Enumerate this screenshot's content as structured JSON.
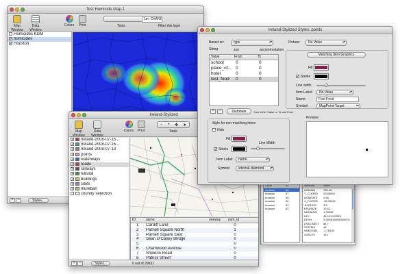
{
  "map_window": {
    "title": "Test Homicide Map-1",
    "toolbar": {
      "map_window": "Map Window",
      "data_window": "Data Window",
      "colors": "Colors",
      "print": "Print",
      "tools": "Tools",
      "zoom_value": "1in: CHANGE",
      "filter_label": "Filter this layer"
    },
    "layers": [
      {
        "name": "Homicides KDM",
        "checked": false,
        "selected": false
      },
      {
        "name": "homicides",
        "checked": true,
        "selected": true
      },
      {
        "name": "Houston",
        "checked": true,
        "selected": false
      }
    ],
    "footer": {
      "add": "+",
      "remove": "−",
      "styles": "Styles..."
    }
  },
  "ireland_window": {
    "title": "Ireland-Stylized",
    "toolbar": {
      "map_window": "Map Window",
      "data_window": "Data Window",
      "colors": "Colors",
      "print": "Print",
      "tools": "Tools"
    },
    "layers": [
      {
        "name": "Ireland-2008-07-15...",
        "checked": true,
        "color": "#d33"
      },
      {
        "name": "Ireland-2008-07-15...",
        "checked": true,
        "color": "#39c"
      },
      {
        "name": "Ireland-2008-07-13",
        "checked": true,
        "color": "#888"
      },
      {
        "name": "points",
        "checked": true,
        "color": "#c9c"
      },
      {
        "name": "waterways",
        "checked": true,
        "color": "#36c"
      },
      {
        "name": "roads",
        "checked": true,
        "color": "#c33"
      },
      {
        "name": "railways",
        "checked": true,
        "color": "#555"
      },
      {
        "name": "natural",
        "checked": true,
        "color": "#393"
      },
      {
        "name": "buildings",
        "checked": true,
        "color": "#cc3"
      },
      {
        "name": "cities",
        "checked": true,
        "color": "#c6c"
      },
      {
        "name": "ntureban",
        "checked": true,
        "color": "#9c6"
      },
      {
        "name": "country selection",
        "checked": false,
        "color": "#fff"
      }
    ],
    "table": {
      "columns": [
        "ID",
        "name",
        "oneway",
        "osm_id"
      ],
      "rows": [
        [
          "1",
          "Cardiff Lane",
          "",
          "0"
        ],
        [
          "2",
          "Parnell Square North",
          "",
          "1"
        ],
        [
          "3",
          "Parnell Square East",
          "",
          "0"
        ],
        [
          "4",
          "Sean O'Casey Bridge",
          "",
          "0"
        ],
        [
          "5",
          "",
          "",
          "0"
        ],
        [
          "6",
          "Chamwood Avenue",
          "",
          "0"
        ],
        [
          "7",
          "Shelerin Road",
          "",
          "0"
        ],
        [
          "8",
          "Patrick Street",
          "",
          "0"
        ]
      ],
      "status": "0 out of 29631"
    },
    "footer": {
      "add": "+",
      "remove": "−",
      "styles": "Styles..."
    }
  },
  "styles_window": {
    "title": "Ireland-Stylized Styles: points",
    "based_on_label": "Based on:",
    "based_on_value": "type",
    "string_label": "String",
    "col_headers": [
      "zoo",
      "accommodation"
    ],
    "picture_label": "Picture:",
    "picture_value": "No Value",
    "matching_header": "Matching Item Graphics",
    "value_table": {
      "columns": [
        "Value",
        "From",
        "To"
      ],
      "rows": [
        [
          "school",
          "0",
          "0"
        ],
        [
          "place_of...",
          "0",
          "0"
        ],
        [
          "hotel",
          "0",
          "0"
        ],
        [
          "fast_food",
          "0",
          "0"
        ]
      ]
    },
    "fill_label": "Fill:",
    "stroke_label": "Stroke",
    "line_width_label": "Line width",
    "item_label_label": "Item Label:",
    "item_label_value": "No Value",
    "name_label": "Name:",
    "name_value": "Fast Food",
    "symbol_label": "Symbol:",
    "symbol_value": "MapPoint-Target",
    "add": "+",
    "remove": "−",
    "distribute": "Distribute",
    "distribute_hint": "Use either Value or To and From",
    "nonmatching_header": "Style for non-matching items",
    "hide_label": "Hide",
    "nm_fill_label": "Fill:",
    "nm_stroke_label": "Stroke",
    "nm_line_width_label": "Line Width",
    "nm_item_label_label": "Item Label:",
    "nm_item_label_value": "name",
    "nm_symbol_label": "Symbol:",
    "nm_symbol_value": "internal-diamond",
    "preview_label": "Preview",
    "colors": {
      "fill": "#8a1c4a",
      "stroke": "#000000",
      "nm_fill": "#8a1c4a",
      "nm_stroke": "#000000"
    }
  },
  "selection_window": {
    "title": "Selection",
    "left_columns": [
      "Layer",
      "ID"
    ],
    "left_rows": [
      [
        "houston",
        "56"
      ],
      [
        "houston",
        "57"
      ],
      [
        "houston",
        "59"
      ],
      [
        "houston",
        "60"
      ],
      [
        "houston",
        "61"
      ],
      [
        "houston",
        "62"
      ]
    ],
    "right_columns": [
      "Attribute",
      "Value"
    ],
    "right_rows": [
      [
        "DOMAIN",
        "750.46"
      ],
      [
        "Y_COORD",
        "29.85053"
      ],
      [
        "HOMRATE",
        "2.48"
      ],
      [
        "X_COORD",
        "-95.30931"
      ],
      [
        "JUVRATE",
        "3.5"
      ],
      [
        "EPURATE",
        "10.42"
      ],
      [
        "NDEADVA",
        "1.25532"
      ],
      [
        "KEY",
        "48.201.022501"
      ],
      [
        "DEVH",
        "5.2800000000000001"
      ],
      [
        "DVACANCY",
        "84.7"
      ],
      [
        "STATEID",
        "48"
      ],
      [
        "NNEDTAB...",
        "-1.78138"
      ],
      [
        "SUNLEV",
        "144"
      ]
    ]
  }
}
